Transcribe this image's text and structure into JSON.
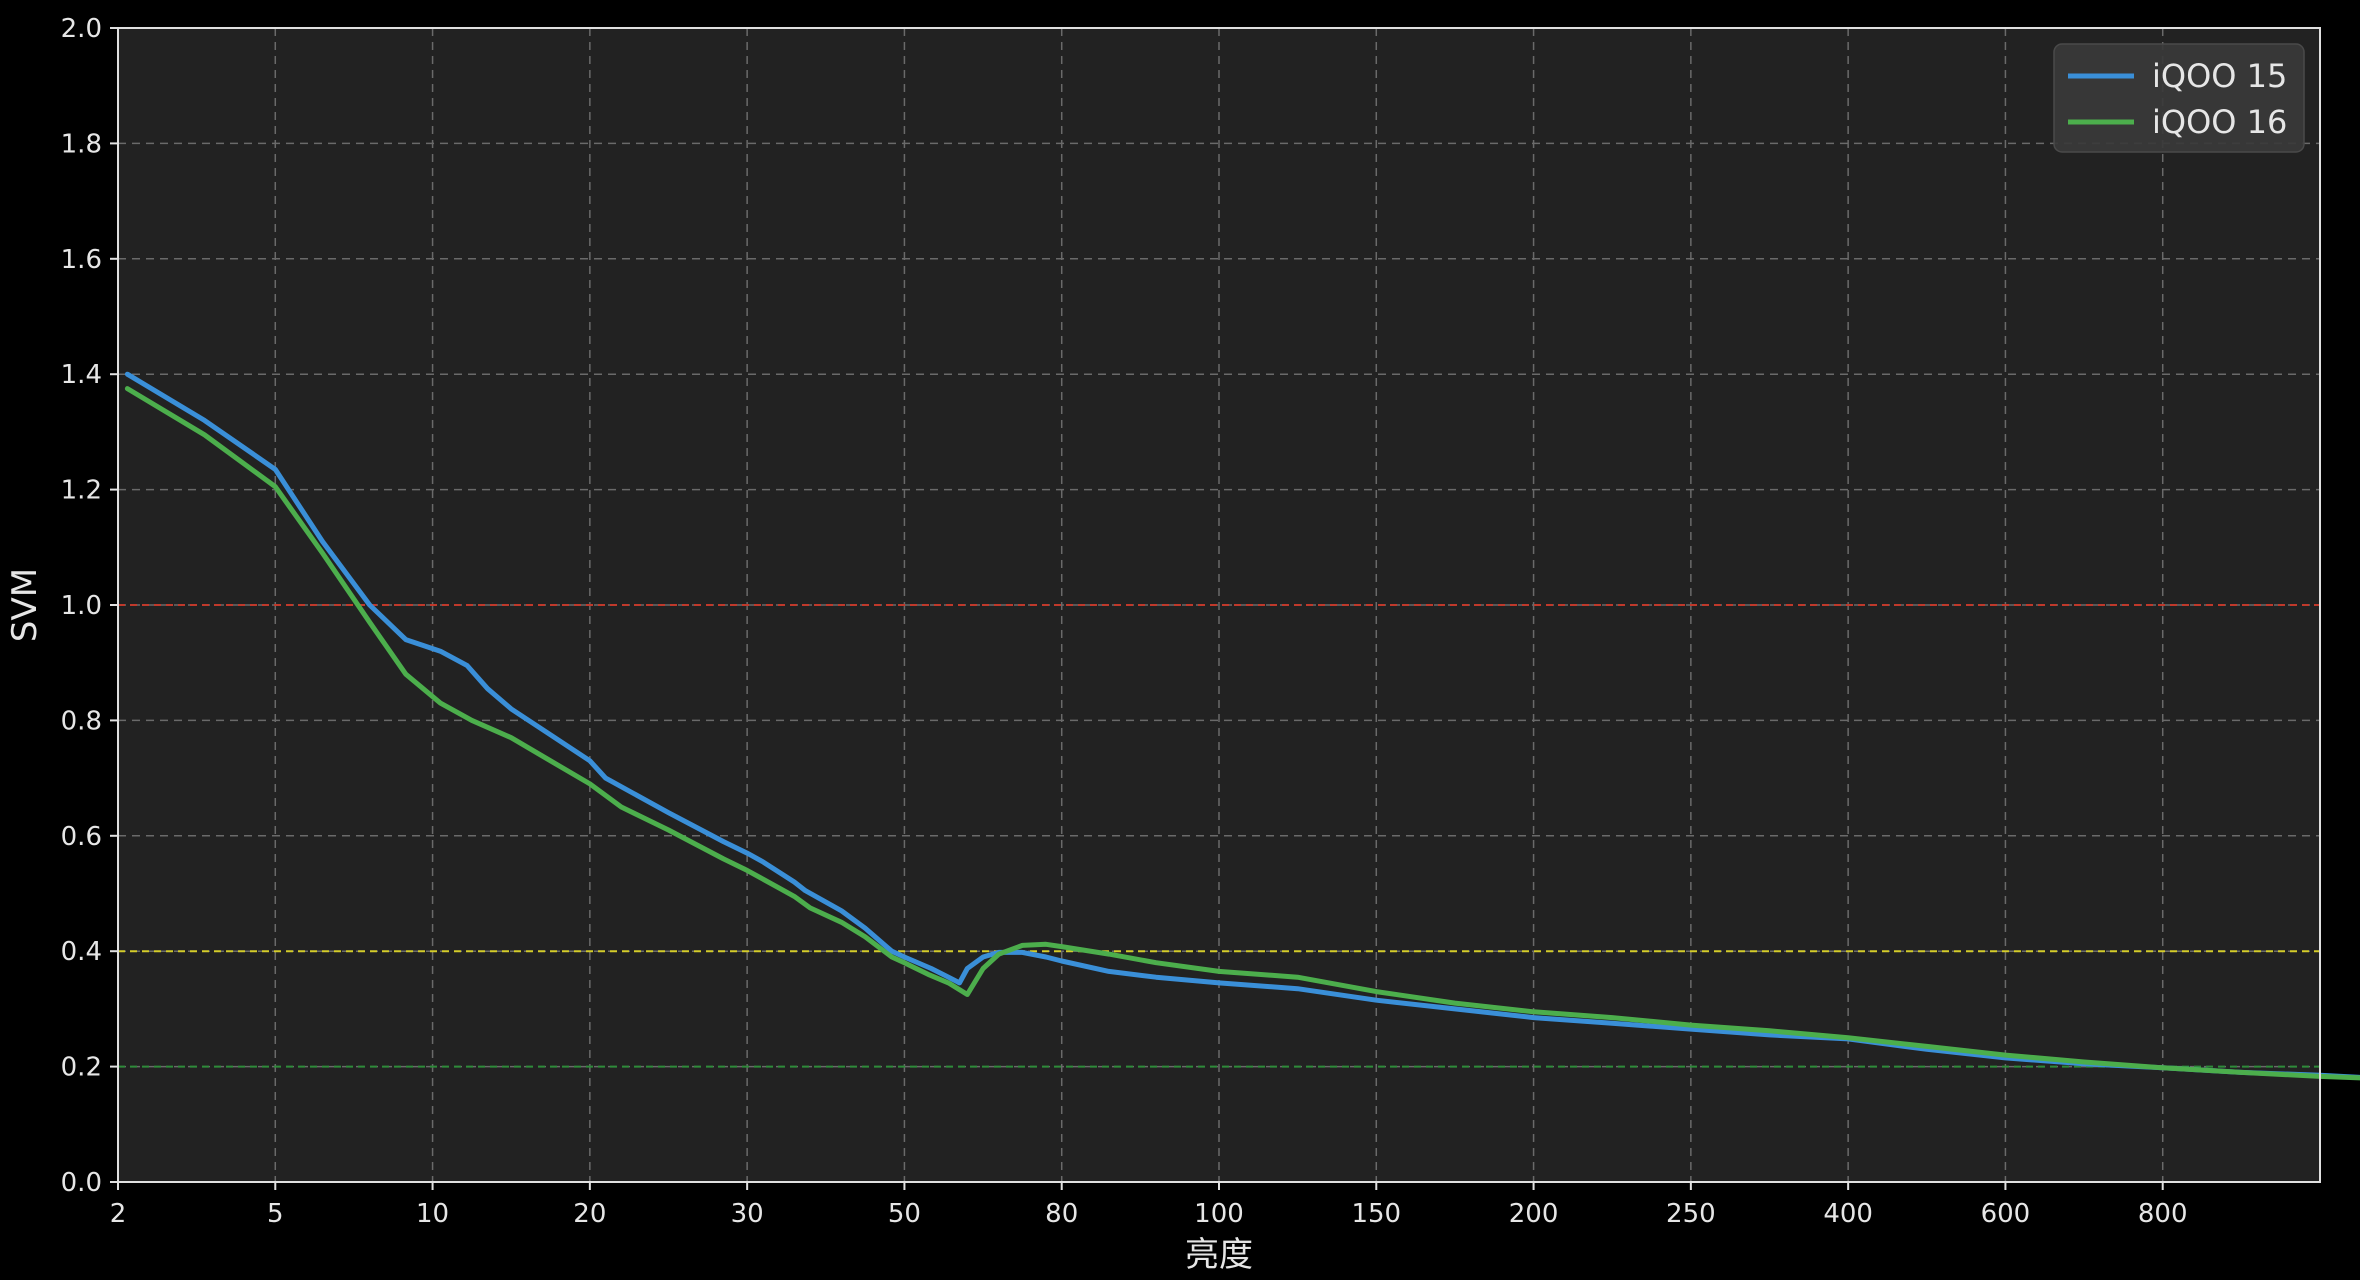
{
  "chart_data": {
    "type": "line",
    "xlabel": "亮度",
    "ylabel": "SVM",
    "x_scale": "categorical (evenly spaced ticks)",
    "x_ticks": [
      "2",
      "5",
      "10",
      "20",
      "30",
      "50",
      "80",
      "100",
      "150",
      "200",
      "250",
      "400",
      "600",
      "800"
    ],
    "y_ticks": [
      "0.0",
      "0.2",
      "0.4",
      "0.6",
      "0.8",
      "1.0",
      "1.2",
      "1.4",
      "1.6",
      "1.8",
      "2.0"
    ],
    "ylim": [
      0,
      2
    ],
    "grid": true,
    "legend_position": "top-right",
    "background": "#222222",
    "reference_lines": [
      {
        "y": 1.0,
        "color": "#c0392b"
      },
      {
        "y": 0.4,
        "color": "#d4cc2a"
      },
      {
        "y": 0.2,
        "color": "#2e8b3a"
      }
    ],
    "series": [
      {
        "name": "iQOO 15",
        "color": "#3a8fd8",
        "points": [
          [
            0.06,
            1.4
          ],
          [
            0.55,
            1.32
          ],
          [
            1.0,
            1.235
          ],
          [
            1.3,
            1.11
          ],
          [
            1.6,
            1.0
          ],
          [
            1.83,
            0.94
          ],
          [
            2.05,
            0.92
          ],
          [
            2.22,
            0.895
          ],
          [
            2.35,
            0.855
          ],
          [
            2.5,
            0.82
          ],
          [
            2.75,
            0.775
          ],
          [
            3.0,
            0.73
          ],
          [
            3.1,
            0.7
          ],
          [
            3.5,
            0.64
          ],
          [
            3.85,
            0.59
          ],
          [
            4.0,
            0.57
          ],
          [
            4.1,
            0.555
          ],
          [
            4.3,
            0.52
          ],
          [
            4.37,
            0.505
          ],
          [
            4.6,
            0.47
          ],
          [
            4.75,
            0.44
          ],
          [
            4.92,
            0.4
          ],
          [
            5.0,
            0.39
          ],
          [
            5.17,
            0.37
          ],
          [
            5.28,
            0.355
          ],
          [
            5.35,
            0.345
          ],
          [
            5.4,
            0.37
          ],
          [
            5.5,
            0.39
          ],
          [
            5.6,
            0.398
          ],
          [
            5.75,
            0.398
          ],
          [
            5.9,
            0.39
          ],
          [
            6.0,
            0.383
          ],
          [
            6.3,
            0.365
          ],
          [
            6.6,
            0.355
          ],
          [
            7.0,
            0.345
          ],
          [
            7.5,
            0.335
          ],
          [
            8.0,
            0.315
          ],
          [
            8.5,
            0.3
          ],
          [
            9.0,
            0.285
          ],
          [
            9.5,
            0.275
          ],
          [
            10.0,
            0.265
          ],
          [
            10.5,
            0.255
          ],
          [
            11.0,
            0.248
          ],
          [
            11.5,
            0.23
          ],
          [
            12.0,
            0.215
          ],
          [
            12.5,
            0.205
          ],
          [
            13.0,
            0.198
          ],
          [
            13.5,
            0.19
          ],
          [
            14.0,
            0.185
          ],
          [
            14.5,
            0.178
          ],
          [
            15.0,
            0.172
          ]
        ]
      },
      {
        "name": "iQOO 16",
        "color": "#4cae4c",
        "points": [
          [
            0.06,
            1.375
          ],
          [
            0.55,
            1.295
          ],
          [
            1.0,
            1.205
          ],
          [
            1.3,
            1.09
          ],
          [
            1.6,
            0.97
          ],
          [
            1.83,
            0.88
          ],
          [
            2.05,
            0.83
          ],
          [
            2.25,
            0.8
          ],
          [
            2.5,
            0.77
          ],
          [
            2.75,
            0.73
          ],
          [
            3.0,
            0.69
          ],
          [
            3.2,
            0.65
          ],
          [
            3.5,
            0.61
          ],
          [
            3.85,
            0.56
          ],
          [
            4.0,
            0.54
          ],
          [
            4.1,
            0.525
          ],
          [
            4.3,
            0.495
          ],
          [
            4.4,
            0.475
          ],
          [
            4.6,
            0.45
          ],
          [
            4.75,
            0.425
          ],
          [
            4.92,
            0.39
          ],
          [
            5.0,
            0.38
          ],
          [
            5.15,
            0.36
          ],
          [
            5.28,
            0.345
          ],
          [
            5.4,
            0.325
          ],
          [
            5.5,
            0.37
          ],
          [
            5.6,
            0.395
          ],
          [
            5.75,
            0.41
          ],
          [
            5.9,
            0.412
          ],
          [
            6.0,
            0.408
          ],
          [
            6.3,
            0.395
          ],
          [
            6.6,
            0.38
          ],
          [
            7.0,
            0.365
          ],
          [
            7.5,
            0.355
          ],
          [
            8.0,
            0.33
          ],
          [
            8.5,
            0.31
          ],
          [
            9.0,
            0.295
          ],
          [
            9.5,
            0.285
          ],
          [
            10.0,
            0.272
          ],
          [
            10.5,
            0.262
          ],
          [
            11.0,
            0.25
          ],
          [
            11.5,
            0.235
          ],
          [
            12.0,
            0.22
          ],
          [
            12.5,
            0.208
          ],
          [
            13.0,
            0.198
          ],
          [
            13.5,
            0.19
          ],
          [
            14.0,
            0.183
          ],
          [
            14.5,
            0.178
          ],
          [
            15.0,
            0.173
          ]
        ]
      }
    ]
  }
}
